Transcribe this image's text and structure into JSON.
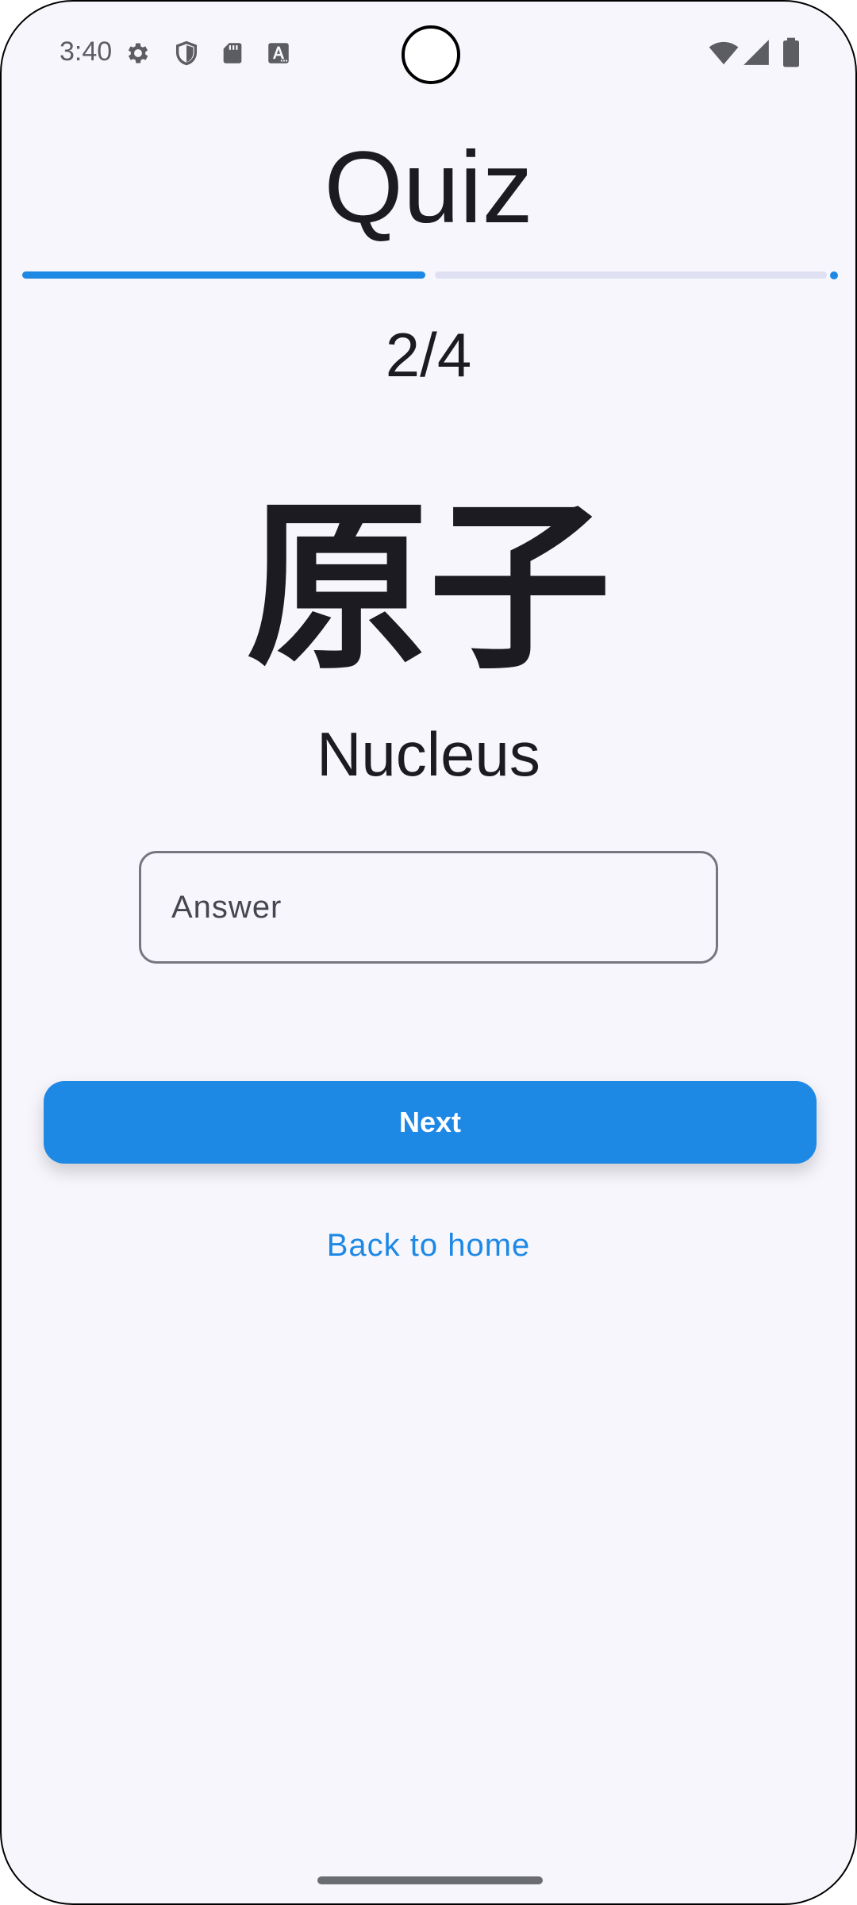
{
  "status_bar": {
    "time": "3:40",
    "left_icons": [
      "settings-icon",
      "shield-icon",
      "sd-card-icon",
      "text-a-icon"
    ],
    "right_icons": [
      "wifi-icon",
      "cell-signal-icon",
      "battery-icon"
    ]
  },
  "title": "Quiz",
  "progress": {
    "current": 2,
    "total": 4,
    "label": "2/4",
    "fraction": 0.5
  },
  "question": {
    "kanji": "原子",
    "meaning": "Nucleus"
  },
  "answer_input": {
    "placeholder": "Answer",
    "value": ""
  },
  "next_button": {
    "label": "Next"
  },
  "back_link": {
    "label": "Back to home"
  },
  "colors": {
    "accent": "#1e88e5",
    "background": "#f7f6fc",
    "text": "#1b1b21",
    "track": "#dfe1f3"
  }
}
